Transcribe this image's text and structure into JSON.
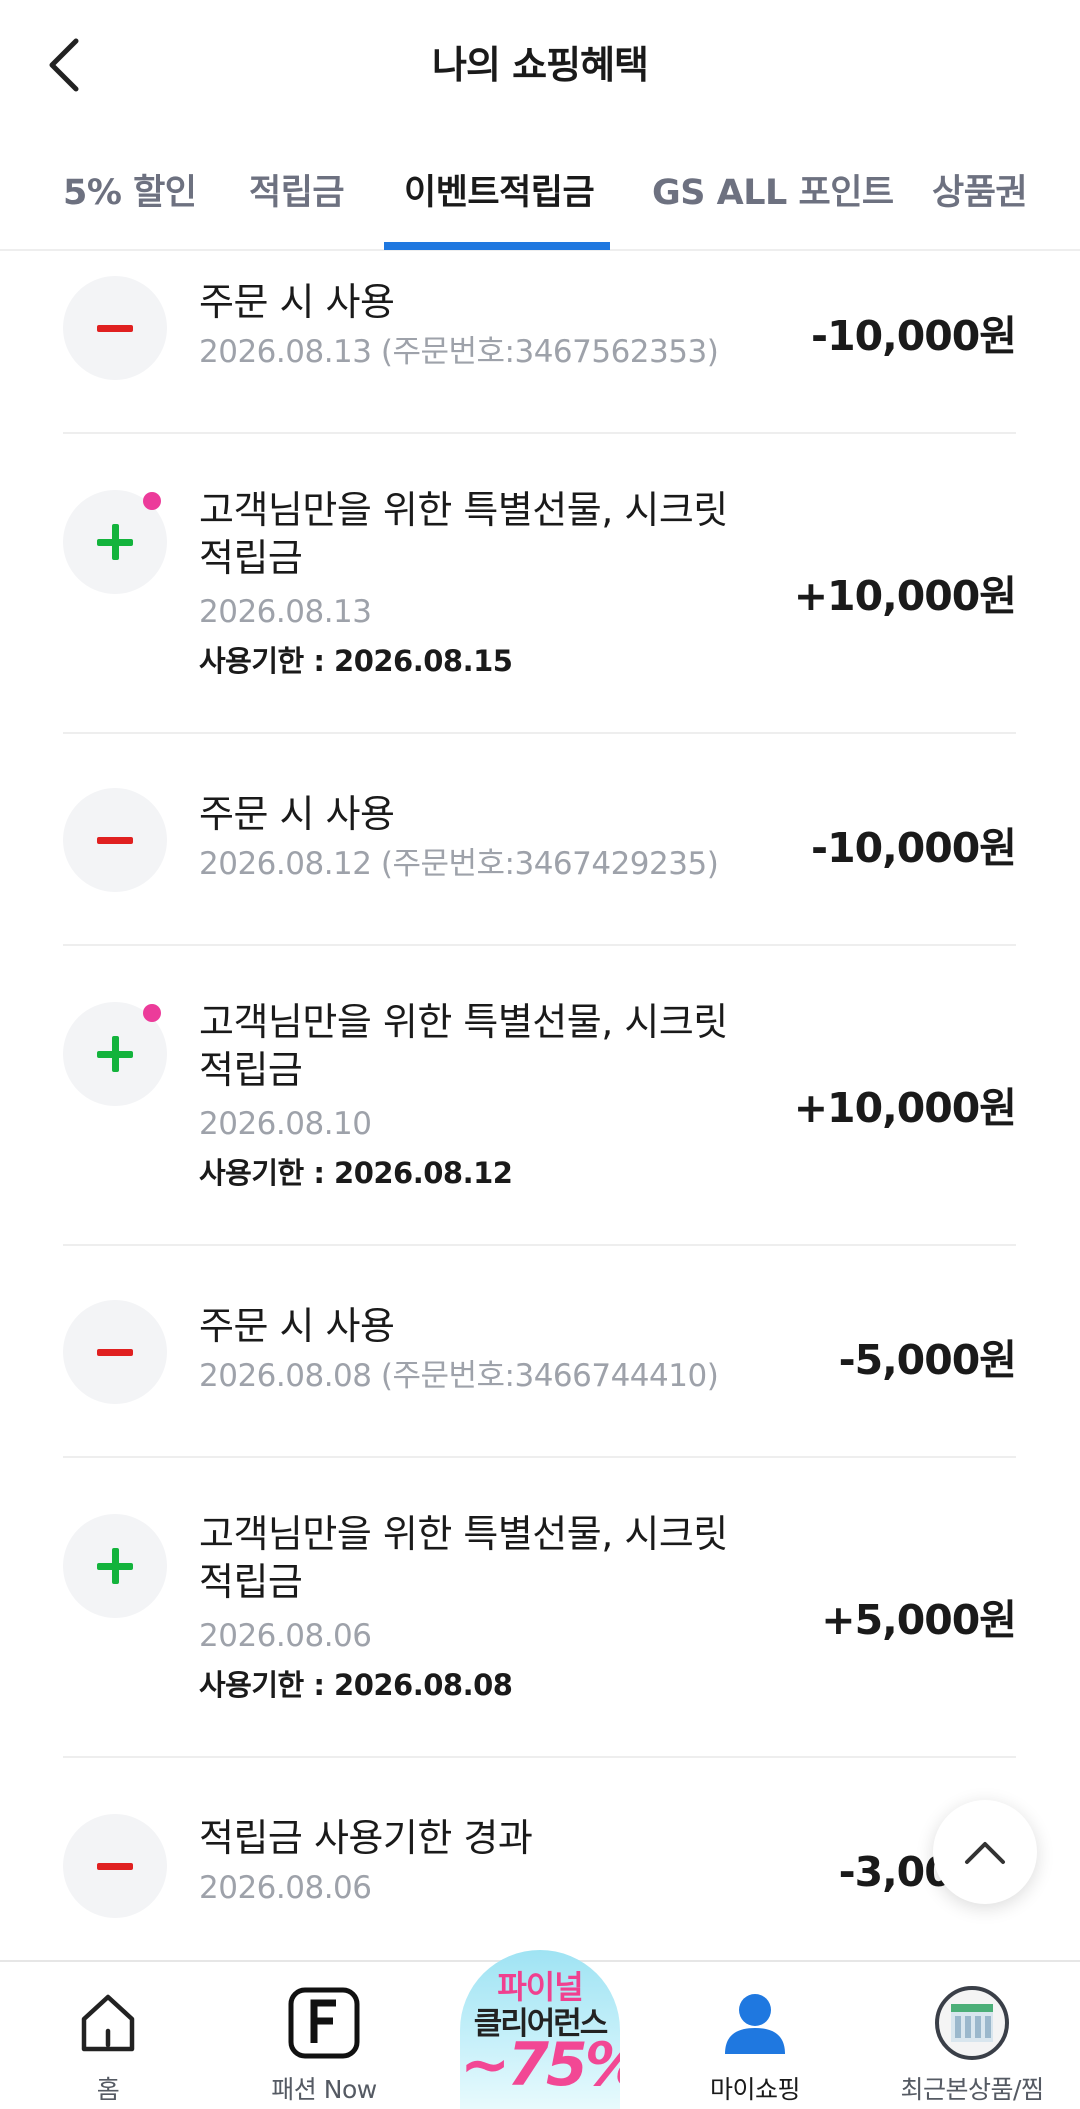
{
  "header": {
    "title": "나의 쇼핑혜택"
  },
  "tabs": [
    {
      "label": "5% 할인"
    },
    {
      "label": "적립금"
    },
    {
      "label": "이벤트적립금"
    },
    {
      "label": "GS ALL 포인트"
    },
    {
      "label": "상품권"
    }
  ],
  "active_tab": "이벤트적립금",
  "colors": {
    "accent": "#1f78e0",
    "minus": "#e02020",
    "plus": "#13b33c",
    "new_dot": "#ec3b9a"
  },
  "transactions": [
    {
      "type": "minus",
      "title": "주문 시 사용",
      "date": "2026.08.13 (주문번호:3467562353)",
      "amount": "-10,000원"
    },
    {
      "type": "plus",
      "is_new": true,
      "title": "고객님만을 위한 특별선물, 시크릿 적립금",
      "date": "2026.08.13",
      "expiry": "사용기한 : 2026.08.15",
      "amount": "+10,000원"
    },
    {
      "type": "minus",
      "title": "주문 시 사용",
      "date": "2026.08.12 (주문번호:3467429235)",
      "amount": "-10,000원"
    },
    {
      "type": "plus",
      "is_new": true,
      "title": "고객님만을 위한 특별선물, 시크릿 적립금",
      "date": "2026.08.10",
      "expiry": "사용기한 : 2026.08.12",
      "amount": "+10,000원"
    },
    {
      "type": "minus",
      "title": "주문 시 사용",
      "date": "2026.08.08 (주문번호:3466744410)",
      "amount": "-5,000원"
    },
    {
      "type": "plus",
      "is_new": false,
      "title": "고객님만을 위한 특별선물, 시크릿 적립금",
      "date": "2026.08.06",
      "expiry": "사용기한 : 2026.08.08",
      "amount": "+5,000원"
    },
    {
      "type": "minus",
      "title": "적립금 사용기한 경과",
      "date": "2026.08.06",
      "amount": "-3,000원"
    }
  ],
  "bottom_nav": {
    "home": "홈",
    "fashion": "패션 Now",
    "promo": {
      "line1": "파이널",
      "line2": "클리어런스",
      "line3": "~75%"
    },
    "myshopping": "마이쇼핑",
    "recent": "최근본상품/찜"
  },
  "icons": {
    "back": "chevron-left-icon",
    "scroll_top": "chevron-up-icon",
    "home": "house-icon",
    "fashion": "f-letter-icon",
    "myshopping": "person-icon",
    "recent": "product-thumbnail-icon"
  }
}
